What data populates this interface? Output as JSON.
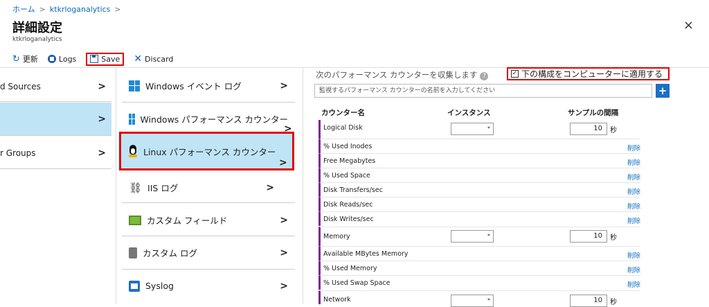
{
  "breadcrumb": {
    "home": "ホーム",
    "workspace": "ktkrloganalytics",
    "sep": ">"
  },
  "header": {
    "title": "詳細設定",
    "subtitle": "ktkrloganalytics",
    "close": "×"
  },
  "toolbar": {
    "refresh": "更新",
    "logs": "Logs",
    "save": "Save",
    "discard": "Discard"
  },
  "left_menu": [
    {
      "label": "d Sources",
      "selected": false
    },
    {
      "label": "",
      "selected": true
    },
    {
      "label": "r Groups",
      "selected": false
    }
  ],
  "mid_menu": [
    {
      "label": "Windows イベント ログ",
      "icon": "windows-icon"
    },
    {
      "label": "Windows パフォーマンス カウンター",
      "icon": "windows-icon"
    },
    {
      "label": "Linux パフォーマンス カウンター",
      "icon": "linux-penguin-icon"
    },
    {
      "label": "IIS ログ",
      "icon": "network-tree-icon"
    },
    {
      "label": "カスタム フィールド",
      "icon": "custom-field-icon"
    },
    {
      "label": "カスタム ログ",
      "icon": "custom-log-icon"
    },
    {
      "label": "Syslog",
      "icon": "syslog-icon"
    }
  ],
  "counters": {
    "collect_label": "次のパフォーマンス カウンターを収集します",
    "apply_label": "下の構成をコンピューターに適用する",
    "apply_checked": true,
    "search_placeholder": "監視するパフォーマンス カウンターの名前を入力してください",
    "add": "+",
    "col_counter": "カウンター名",
    "col_instance": "インスタンス",
    "col_interval": "サンプルの間隔",
    "delete_label": "削除",
    "unit": "秒",
    "select_arrow": "*",
    "groups": [
      {
        "name": "Logical Disk",
        "interval": "10",
        "items": [
          "% Used Inodes",
          "Free Megabytes",
          "% Used Space",
          "Disk Transfers/sec",
          "Disk Reads/sec",
          "Disk Writes/sec"
        ]
      },
      {
        "name": "Memory",
        "interval": "10",
        "items": [
          "Available MBytes Memory",
          "% Used Memory",
          "% Used Swap Space"
        ]
      },
      {
        "name": "Network",
        "interval": "10",
        "items": []
      }
    ]
  },
  "colors": {
    "accent": "#1e6fc6",
    "highlight": "#e00000",
    "selected_bg": "#bfe4f5",
    "group_bar": "#7b2a8c"
  }
}
